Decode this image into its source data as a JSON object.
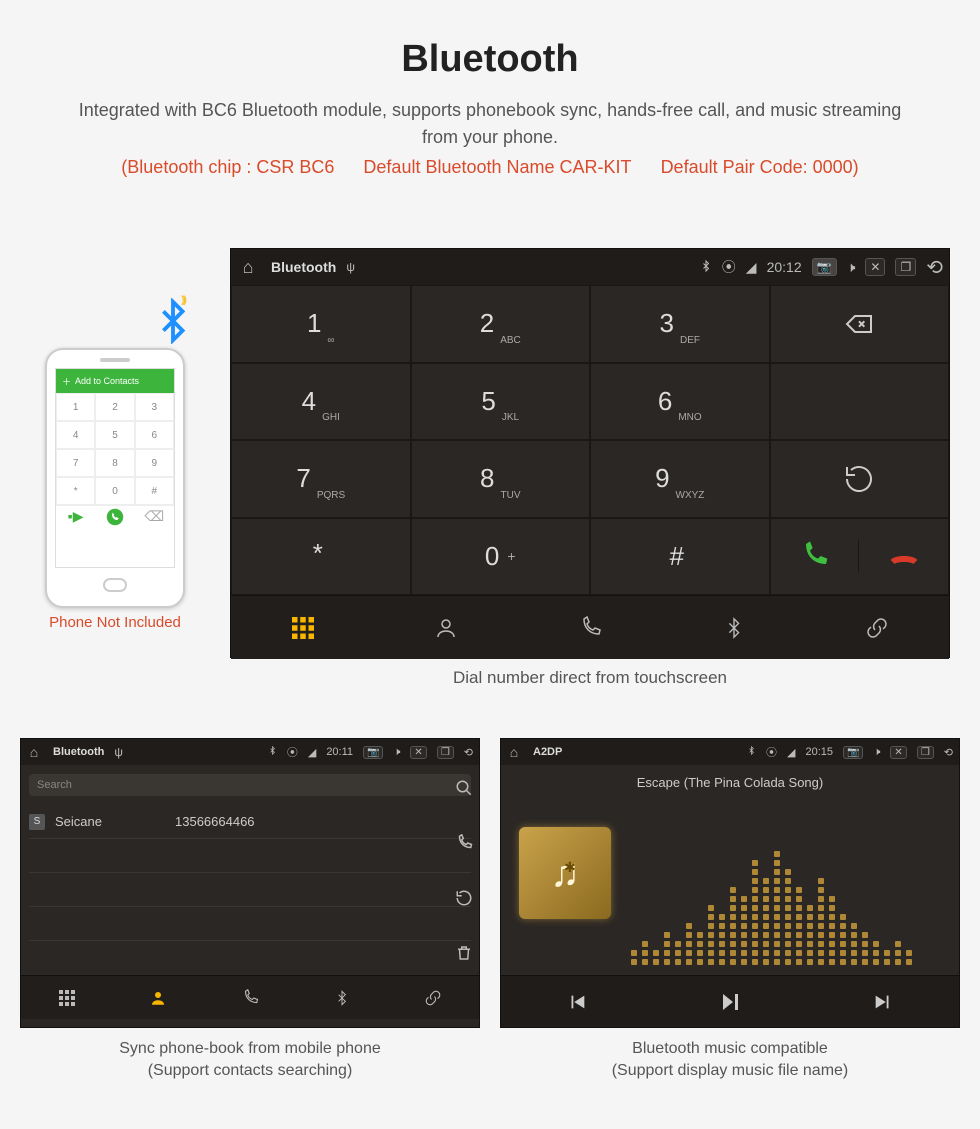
{
  "header": {
    "title": "Bluetooth",
    "intro": "Integrated with BC6 Bluetooth module, supports phonebook sync, hands-free call, and music streaming from your phone.",
    "spec1": "(Bluetooth chip : CSR BC6",
    "spec2": "Default Bluetooth Name CAR-KIT",
    "spec3": "Default Pair Code: 0000)"
  },
  "phone_illustration": {
    "header_label": "Add to Contacts",
    "caption": "Phone Not Included",
    "keys": [
      "1",
      "2",
      "3",
      "4",
      "5",
      "6",
      "7",
      "8",
      "9",
      "*",
      "0",
      "#"
    ]
  },
  "main_device": {
    "status": {
      "title": "Bluetooth",
      "time": "20:12"
    },
    "keys": [
      {
        "n": "1",
        "s": "∞"
      },
      {
        "n": "2",
        "s": "ABC"
      },
      {
        "n": "3",
        "s": "DEF"
      },
      {
        "n": "4",
        "s": "GHI"
      },
      {
        "n": "5",
        "s": "JKL"
      },
      {
        "n": "6",
        "s": "MNO"
      },
      {
        "n": "7",
        "s": "PQRS"
      },
      {
        "n": "8",
        "s": "TUV"
      },
      {
        "n": "9",
        "s": "WXYZ"
      },
      {
        "n": "*",
        "s": ""
      },
      {
        "n": "0",
        "s": "+"
      },
      {
        "n": "#",
        "s": ""
      }
    ],
    "caption": "Dial number direct from touchscreen"
  },
  "phonebook_device": {
    "status": {
      "title": "Bluetooth",
      "time": "20:11"
    },
    "search_placeholder": "Search",
    "contact": {
      "badge": "S",
      "name": "Seicane",
      "number": "13566664466"
    },
    "caption_l1": "Sync phone-book from mobile phone",
    "caption_l2": "(Support contacts searching)"
  },
  "music_device": {
    "status": {
      "title": "A2DP",
      "time": "20:15"
    },
    "track_title": "Escape (The Pina Colada Song)",
    "caption_l1": "Bluetooth music compatible",
    "caption_l2": "(Support display music file name)"
  }
}
